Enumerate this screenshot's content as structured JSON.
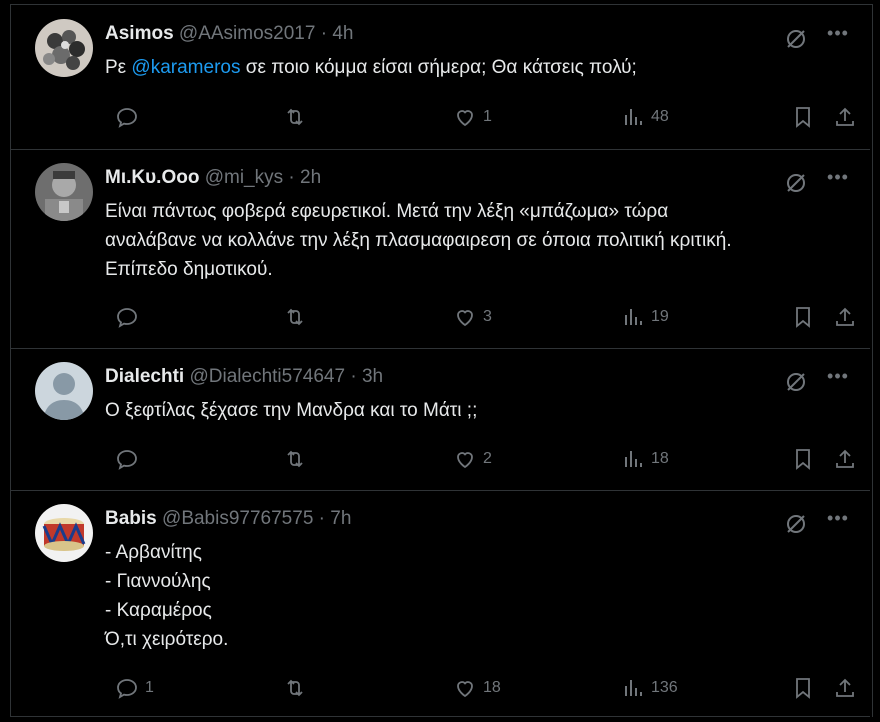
{
  "tweets": [
    {
      "name": "Asimos",
      "handle": "@AAsimos2017",
      "separator": "·",
      "time": "4h",
      "text_before": "Ρε ",
      "mention": "@karameros",
      "text_after": " σε ποιο κόμμα είσαι σήμερα; Θα κάτσεις πολύ;",
      "lines": [],
      "replies": "",
      "reposts": "",
      "likes": "1",
      "views": "48",
      "avatar": "photo-avatar"
    },
    {
      "name": "Μι.Κυ.Οοο",
      "handle": "@mi_kys",
      "separator": "·",
      "time": "2h",
      "lines": [
        "Είναι πάντως φοβερά εφευρετικοί. Μετά την λέξη «μπάζωμα» τώρα",
        "αναλάβανε να κολλάνε την λέξη πλασμαφαιρεση σε όποια πολιτική κριτική.",
        "Επίπεδο δημοτικού."
      ],
      "replies": "",
      "reposts": "",
      "likes": "3",
      "views": "19",
      "avatar": "photo-avatar"
    },
    {
      "name": "Dialechti",
      "handle": "@Dialechti574647",
      "separator": "·",
      "time": "3h",
      "lines": [
        "Ο ξεφτίλας ξέχασε την Μανδρα και το Μάτι ;;"
      ],
      "replies": "",
      "reposts": "",
      "likes": "2",
      "views": "18",
      "avatar": "default-avatar"
    },
    {
      "name": "Babis",
      "handle": "@Babis97767575",
      "separator": "·",
      "time": "7h",
      "lines": [
        "- Αρβανίτης",
        "- Γιαννούλης",
        "- Καραμέρος",
        "Ό,τι χειρότερο."
      ],
      "replies": "1",
      "reposts": "",
      "likes": "18",
      "views": "136",
      "avatar": "drum-avatar"
    }
  ],
  "icons": {
    "grok": "grok-icon",
    "more": "more-icon",
    "reply": "reply-icon",
    "repost": "repost-icon",
    "like": "heart-icon",
    "views": "views-icon",
    "bookmark": "bookmark-icon",
    "share": "share-icon"
  },
  "colors": {
    "background": "#000000",
    "text": "#e7e9ea",
    "secondary": "#71767b",
    "link": "#1d9bf0",
    "border": "#2f3336"
  }
}
